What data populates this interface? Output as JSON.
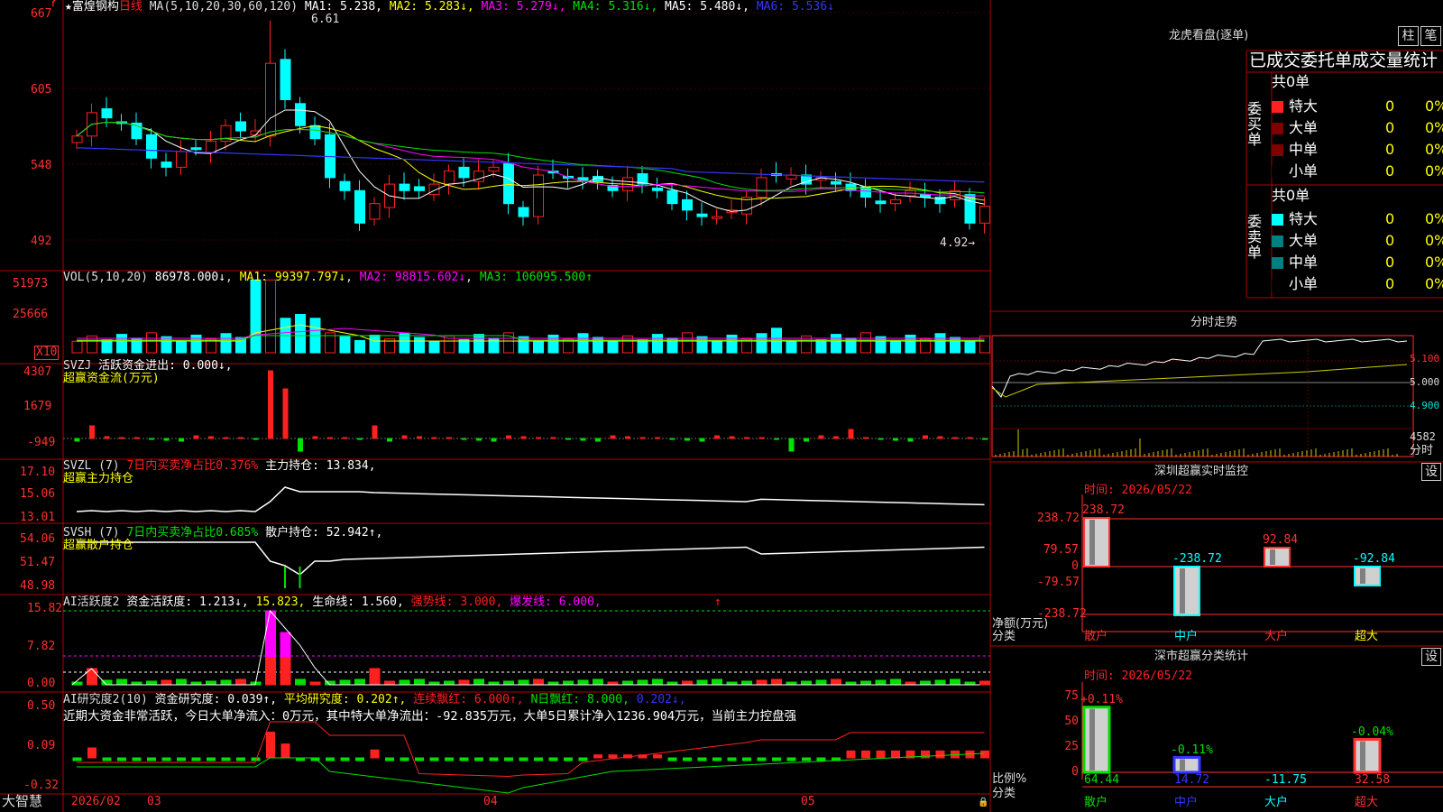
{
  "header": {
    "star": "★",
    "stock": "富煌钢构",
    "period": "日线",
    "ma_label": "MA(5,10,20,30,60,120)",
    "ma": [
      {
        "name": "MA1:",
        "value": "5.238",
        "arrow": "",
        "color": "#ffffff"
      },
      {
        "name": "MA2:",
        "value": "5.283",
        "arrow": "↓",
        "color": "#ffff00"
      },
      {
        "name": "MA3:",
        "value": "5.279",
        "arrow": "↓",
        "color": "#ff00ff"
      },
      {
        "name": "MA4:",
        "value": "5.316",
        "arrow": "↓",
        "color": "#00e000"
      },
      {
        "name": "MA5:",
        "value": "5.480",
        "arrow": "↓",
        "color": "#ffffff"
      },
      {
        "name": "MA6:",
        "value": "5.536",
        "arrow": "↓",
        "color": "#3535ff"
      }
    ],
    "high_mark": "6.61",
    "low_mark": "4.92→"
  },
  "colors": {
    "up": "#ff2020",
    "down": "#00ffff",
    "grid": "#b00000",
    "axis": "#ff3030",
    "ma1": "#ffffff",
    "ma2": "#ffff00",
    "ma3": "#ff00ff",
    "ma4": "#00e000",
    "ma6": "#3535ff"
  },
  "main_axis": [
    "667",
    "605",
    "548",
    "492"
  ],
  "vol": {
    "label": "VOL(5,10,20)",
    "value": "86978.000↓",
    "ma1": "MA1: 99397.797↓",
    "ma2": "MA2: 98815.602↓",
    "ma3": "MA3: 106095.500↑",
    "axis": [
      "51973",
      "25666",
      "X10"
    ]
  },
  "svzj": {
    "label": "SVZJ",
    "title": "活跃资金进出: 0.000↓,",
    "subtitle": "超赢资金流(万元)",
    "axis": [
      "4307",
      "1679",
      "-949"
    ]
  },
  "svzl": {
    "label": "SVZL (7)",
    "pct": "7日内买卖净占比0.376%",
    "hold": "主力持仓: 13.834,",
    "subtitle": "超赢主力持仓",
    "axis": [
      "17.10",
      "15.06",
      "13.01"
    ]
  },
  "svsh": {
    "label": "SVSH (7)",
    "pct": "7日内买卖净占比0.685%",
    "hold": "散户持仓: 52.942↑,",
    "subtitle": "超赢散户持仓",
    "axis": [
      "54.06",
      "51.47",
      "48.98"
    ]
  },
  "ai1": {
    "label": "AI活跃度2",
    "t1": "资金活跃度: 1.213↓,",
    "t2": "15.823,",
    "t3": "生命线: 1.560,",
    "t4": "强势线: 3.000,",
    "t5": "爆发线: 6.000,",
    "arrow": "↑",
    "axis": [
      "15.82",
      "7.82",
      "0.00"
    ]
  },
  "ai2": {
    "label": "AI研究度2(10)",
    "t1": "资金研究度: 0.039↑,",
    "t2": "平均研究度: 0.202↑,",
    "t3": "连续飘红: 6.000↑,",
    "t4": "N日飘红: 8.000,",
    "t5": "0.202↓,",
    "comment": "近期大资金非常活跃，今日大单净流入：0万元，其中特大单净流出：-92.835万元，大单5日累计净入1236.904万元，当前主力控盘强",
    "axis": [
      "0.50",
      "0.09",
      "-0.32"
    ]
  },
  "xaxis": {
    "brand": "大智慧",
    "labels": [
      "2026/02",
      "03",
      "04",
      "05"
    ]
  },
  "right": {
    "lhb_title": "龙虎看盘(逐单)",
    "btn1": "柱",
    "btn2": "笔",
    "stat_title": "已成交委托单成交量统计",
    "buy_label": "委买单",
    "sell_label": "委卖单",
    "buy_total": "共0单",
    "sell_total": "共0单",
    "rows": [
      {
        "name": "特大",
        "count": "0",
        "pct": "0%"
      },
      {
        "name": "大单",
        "count": "0",
        "pct": "0%"
      },
      {
        "name": "中单",
        "count": "0",
        "pct": "0%"
      },
      {
        "name": "小单",
        "count": "0",
        "pct": "0%"
      }
    ],
    "fs_title": "分时走势",
    "fs_prices": [
      "5.100",
      "5.000",
      "4.900"
    ],
    "fs_vol": "4582",
    "fs_tag": "分时",
    "mon_title": "深圳超赢实时监控",
    "mon_btn": "设",
    "mon_time": "时间: 2026/05/22",
    "mon_axis": [
      "238.72",
      "79.57",
      "0",
      "-79.57",
      "-238.72"
    ],
    "mon_ylabel": "净额(万元)",
    "mon_xlabel": "分类",
    "cls_title": "深市超赢分类统计",
    "cls_btn": "设",
    "cls_time": "时间: 2026/05/22",
    "cls_axis": [
      "75",
      "50",
      "25",
      "0"
    ],
    "cls_ylabel": "比例%",
    "cls_xlabel": "分类"
  },
  "chart_data": [
    {
      "type": "bar",
      "title": "深圳超赢实时监控",
      "categories": [
        "散户",
        "中户",
        "大户",
        "超大"
      ],
      "values": [
        238.72,
        -238.72,
        92.84,
        -92.84
      ],
      "ylim": [
        -238.72,
        238.72
      ],
      "ylabel": "净额(万元)",
      "xlabel": "分类"
    },
    {
      "type": "bar",
      "title": "深市超赢分类统计",
      "categories": [
        "散户",
        "中户",
        "大户",
        "超大"
      ],
      "values": [
        64.44,
        14.72,
        -11.75,
        32.58
      ],
      "top_labels": [
        "+0.11%",
        "-0.11%",
        "",
        "-0.04%"
      ],
      "ylim": [
        0,
        75
      ],
      "ylabel": "比例%",
      "xlabel": "分类"
    },
    {
      "type": "bar",
      "title": "日线",
      "kline_close": [
        5.72,
        5.9,
        5.86,
        5.82,
        5.7,
        5.55,
        5.48,
        5.6,
        5.62,
        5.68,
        5.8,
        5.76,
        5.76,
        6.28,
        6.0,
        5.8,
        5.7,
        5.4,
        5.3,
        5.05,
        5.2,
        5.35,
        5.3,
        5.3,
        5.35,
        5.45,
        5.4,
        5.45,
        5.48,
        5.2,
        5.1,
        5.42,
        5.44,
        5.4,
        5.38,
        5.37,
        5.3,
        5.4,
        5.35,
        5.3,
        5.2,
        5.15,
        5.1,
        5.1,
        5.15,
        5.25,
        5.4,
        5.42,
        5.42,
        5.35,
        5.4,
        5.35,
        5.3,
        5.25,
        5.2,
        5.23,
        5.3,
        5.25,
        5.2,
        5.3,
        5.05,
        5.18
      ],
      "ylim": [
        4.92,
        6.67
      ]
    }
  ]
}
